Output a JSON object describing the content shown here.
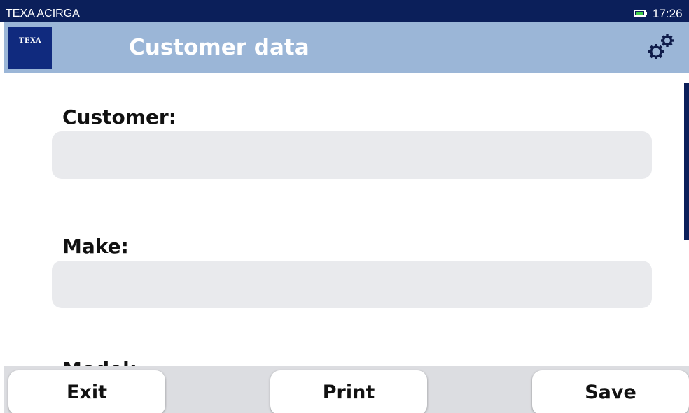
{
  "status_bar": {
    "app_name": "TEXA ACIRGA",
    "time": "17:26",
    "battery_icon": "battery-icon",
    "battery_color": "#3fce48"
  },
  "header": {
    "logo_text": "TEXA",
    "title": "Customer data",
    "settings_icon": "gears-icon",
    "background": "#9bb6d7"
  },
  "form": {
    "fields": [
      {
        "label": "Customer:",
        "value": ""
      },
      {
        "label": "Make:",
        "value": ""
      },
      {
        "label": "Model:",
        "value": ""
      }
    ]
  },
  "bottom_bar": {
    "exit_label": "Exit",
    "print_label": "Print",
    "save_label": "Save"
  },
  "colors": {
    "status_bar": "#0b1f5a",
    "logo_bg": "#102a7e",
    "input_bg": "#e9eaed"
  }
}
